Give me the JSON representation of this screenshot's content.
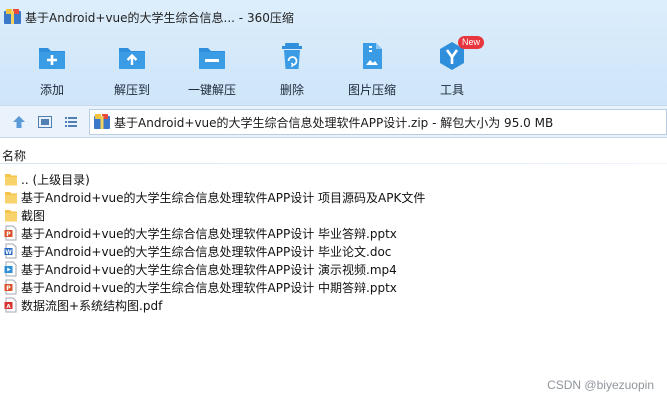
{
  "window": {
    "title": "基于Android+vue的大学生综合信息... - 360压缩"
  },
  "toolbar": {
    "items": [
      {
        "label": "添加",
        "icon": "add-icon"
      },
      {
        "label": "解压到",
        "icon": "extract-to-icon"
      },
      {
        "label": "一键解压",
        "icon": "one-click-extract-icon"
      },
      {
        "label": "删除",
        "icon": "delete-icon"
      },
      {
        "label": "图片压缩",
        "icon": "image-compress-icon"
      },
      {
        "label": "工具",
        "icon": "tools-icon",
        "badge": "New"
      }
    ]
  },
  "address": {
    "path": "基于Android+vue的大学生综合信息处理软件APP设计.zip - 解包大小为 95.0 MB"
  },
  "list": {
    "header": "名称",
    "rows": [
      {
        "name": ".. (上级目录)",
        "icon": "folder-up-icon"
      },
      {
        "name": "基于Android+vue的大学生综合信息处理软件APP设计 项目源码及APK文件",
        "icon": "folder-icon"
      },
      {
        "name": "截图",
        "icon": "folder-icon"
      },
      {
        "name": "基于Android+vue的大学生综合信息处理软件APP设计 毕业答辩.pptx",
        "icon": "pptx-icon"
      },
      {
        "name": "基于Android+vue的大学生综合信息处理软件APP设计 毕业论文.doc",
        "icon": "doc-icon"
      },
      {
        "name": "基于Android+vue的大学生综合信息处理软件APP设计 演示视频.mp4",
        "icon": "video-icon"
      },
      {
        "name": "基于Android+vue的大学生综合信息处理软件APP设计 中期答辩.pptx",
        "icon": "pptx-icon"
      },
      {
        "name": "数据流图+系统结构图.pdf",
        "icon": "pdf-icon"
      }
    ]
  },
  "watermark": "CSDN @biyezuopin",
  "colors": {
    "toolbar_icon": "#2f8fdc",
    "badge": "#e8363f",
    "folder": "#f5c44a"
  }
}
